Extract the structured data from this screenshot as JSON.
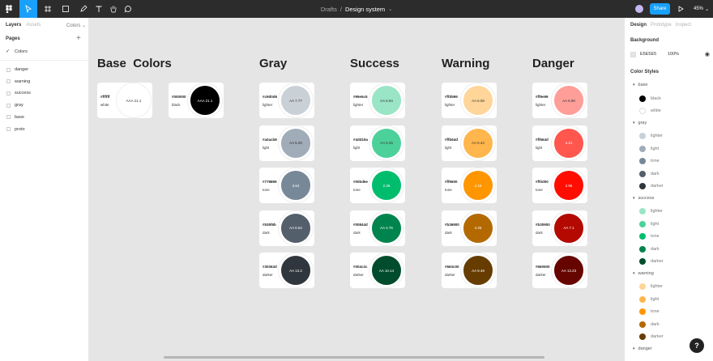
{
  "toolbar": {
    "breadcrumb_parent": "Drafts",
    "breadcrumb_sep": "/",
    "file_name": "Design system",
    "share_label": "Share",
    "zoom": "45%"
  },
  "left_panel": {
    "tabs": [
      "Layers",
      "Assets"
    ],
    "page_dropdown": "Colors",
    "pages_heading": "Pages",
    "current_page": "Colors",
    "layers": [
      "danger",
      "warning",
      "success",
      "gray",
      "base",
      "proto"
    ]
  },
  "right_panel": {
    "tabs": [
      "Design",
      "Prototype",
      "Inspect"
    ],
    "background_heading": "Background",
    "background_hex": "E5E5E5",
    "background_opacity": "100%",
    "styles_heading": "Color Styles",
    "groups": [
      {
        "name": "base",
        "items": [
          {
            "label": "black",
            "color": "#000000"
          },
          {
            "label": "white",
            "color": "#ffffff"
          }
        ]
      },
      {
        "name": "gray",
        "items": [
          {
            "label": "lighter",
            "color": "#c9d0d6"
          },
          {
            "label": "light",
            "color": "#a0acb8"
          },
          {
            "label": "tone",
            "color": "#778899"
          },
          {
            "label": "dark",
            "color": "#535f6b"
          },
          {
            "label": "darker",
            "color": "#30363d"
          }
        ]
      },
      {
        "name": "success",
        "items": [
          {
            "label": "lighter",
            "color": "#99e5c5"
          },
          {
            "label": "light",
            "color": "#4dd19a"
          },
          {
            "label": "tone",
            "color": "#00bd6e"
          },
          {
            "label": "dark",
            "color": "#00844d"
          },
          {
            "label": "darker",
            "color": "#004c2c"
          }
        ]
      },
      {
        "name": "warning",
        "items": [
          {
            "label": "lighter",
            "color": "#ffd599"
          },
          {
            "label": "light",
            "color": "#ffb64d"
          },
          {
            "label": "tone",
            "color": "#ff9600"
          },
          {
            "label": "dark",
            "color": "#b36900"
          },
          {
            "label": "darker",
            "color": "#663c00"
          }
        ]
      },
      {
        "name": "danger",
        "items": []
      }
    ]
  },
  "canvas": {
    "columns": [
      {
        "title": "Base  Colors",
        "cards": []
      },
      {
        "title": "Gray",
        "cards": [
          {
            "hex": "#c9d0d6",
            "name": "lighter",
            "contrast": "AA 7.77",
            "text_color": "#333333"
          },
          {
            "hex": "#a0acb8",
            "name": "light",
            "contrast": "AA 5.28",
            "text_color": "#333333"
          },
          {
            "hex": "#778899",
            "name": "tone",
            "contrast": "3.64",
            "text_color": "#ffffff"
          },
          {
            "hex": "#535f6b",
            "name": "dark",
            "contrast": "AA 6.52",
            "text_color": "#ffffff"
          },
          {
            "hex": "#30363d",
            "name": "darker",
            "contrast": "AA 13.2",
            "text_color": "#ffffff"
          }
        ]
      },
      {
        "title": "Success",
        "cards": [
          {
            "hex": "#99e5c5",
            "name": "lighter",
            "contrast": "AA 6.94",
            "text_color": "#333333"
          },
          {
            "hex": "#4dd19a",
            "name": "light",
            "contrast": "AA 5.26",
            "text_color": "#333333"
          },
          {
            "hex": "#00bd6e",
            "name": "tone",
            "contrast": "2.26",
            "text_color": "#ffffff"
          },
          {
            "hex": "#00844d",
            "name": "dark",
            "contrast": "AA 4.76",
            "text_color": "#ffffff"
          },
          {
            "hex": "#004c2c",
            "name": "darker",
            "contrast": "AA 10.14",
            "text_color": "#ffffff"
          }
        ]
      },
      {
        "title": "Warning",
        "cards": [
          {
            "hex": "#ffd599",
            "name": "lighter",
            "contrast": "AA 6.08",
            "text_color": "#333333"
          },
          {
            "hex": "#ffb64d",
            "name": "light",
            "contrast": "AA 5.44",
            "text_color": "#333333"
          },
          {
            "hex": "#ff9600",
            "name": "tone",
            "contrast": "2.15",
            "text_color": "#ffffff"
          },
          {
            "hex": "#b36900",
            "name": "dark",
            "contrast": "4.25",
            "text_color": "#ffffff"
          },
          {
            "hex": "#663c00",
            "name": "darker",
            "contrast": "AA 9.49",
            "text_color": "#ffffff"
          }
        ]
      },
      {
        "title": "Danger",
        "cards": [
          {
            "hex": "#ff9e99",
            "name": "lighter",
            "contrast": "AA 6.98",
            "text_color": "#333333"
          },
          {
            "hex": "#ff564d",
            "name": "light",
            "contrast": "4.21",
            "text_color": "#ffffff"
          },
          {
            "hex": "#ff0d00",
            "name": "tone",
            "contrast": "2.95",
            "text_color": "#ffffff"
          },
          {
            "hex": "#b30900",
            "name": "dark",
            "contrast": "AA 7.1",
            "text_color": "#ffffff"
          },
          {
            "hex": "#660500",
            "name": "darker",
            "contrast": "AA 13.23",
            "text_color": "#ffffff"
          }
        ]
      }
    ],
    "base_cards": [
      {
        "hex": "#ffffff",
        "name": "white",
        "contrast": "AAA 21.1",
        "text_color": "#333333"
      },
      {
        "hex": "#000000",
        "name": "black",
        "contrast": "AAA 21.1",
        "text_color": "#ffffff"
      }
    ]
  }
}
